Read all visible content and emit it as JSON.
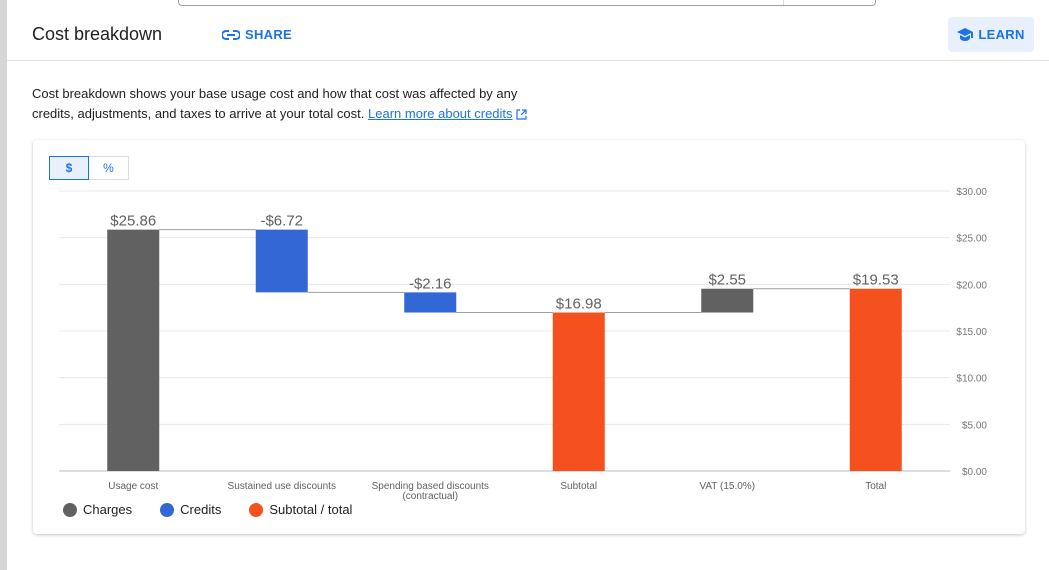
{
  "header": {
    "title": "Cost breakdown",
    "share_label": "SHARE",
    "learn_label": "LEARN"
  },
  "description": {
    "text": "Cost breakdown shows your base usage cost and how that cost was affected by any credits, adjustments, and taxes to arrive at your total cost.",
    "link_label": "Learn more about credits"
  },
  "toggle": {
    "dollar_label": "$",
    "percent_label": "%",
    "selected": "$"
  },
  "colors": {
    "charges": "#616161",
    "credits": "#3367d6",
    "total": "#f4511e",
    "accent": "#1a73e8"
  },
  "legend": [
    {
      "label": "Charges",
      "color": "#616161"
    },
    {
      "label": "Credits",
      "color": "#3367d6"
    },
    {
      "label": "Subtotal / total",
      "color": "#f4511e"
    }
  ],
  "chart_data": {
    "type": "bar",
    "subtype": "waterfall",
    "categories": [
      "Usage cost",
      "Sustained use discounts",
      "Spending based discounts (contractual)",
      "Subtotal",
      "VAT (15.0%)",
      "Total"
    ],
    "bars": [
      {
        "category": "Usage cost",
        "label": "$25.86",
        "start": 0,
        "end": 25.86,
        "kind": "charges"
      },
      {
        "category": "Sustained use discounts",
        "label": "-$6.72",
        "start": 25.86,
        "end": 19.14,
        "kind": "credits"
      },
      {
        "category": "Spending based discounts (contractual)",
        "label": "-$2.16",
        "start": 19.14,
        "end": 16.98,
        "kind": "credits"
      },
      {
        "category": "Subtotal",
        "label": "$16.98",
        "start": 0,
        "end": 16.98,
        "kind": "total"
      },
      {
        "category": "VAT (15.0%)",
        "label": "$2.55",
        "start": 16.98,
        "end": 19.53,
        "kind": "charges"
      },
      {
        "category": "Total",
        "label": "$19.53",
        "start": 0,
        "end": 19.53,
        "kind": "total"
      }
    ],
    "yticks": [
      "$0.00",
      "$5.00",
      "$10.00",
      "$15.00",
      "$20.00",
      "$25.00",
      "$30.00"
    ],
    "ylim": [
      0,
      30
    ],
    "yaxis_position": "right",
    "grid": true,
    "legend_position": "bottom-left"
  }
}
